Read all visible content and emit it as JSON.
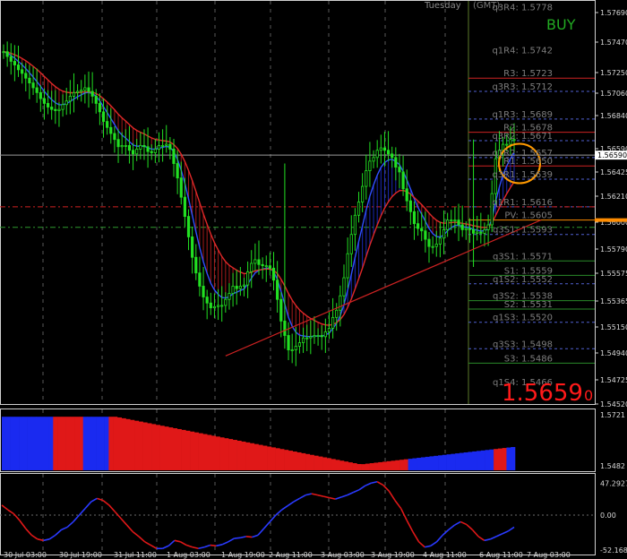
{
  "chart_data": {
    "type": "candlestick",
    "header": {
      "day_label": "Tuesday",
      "tz_label": "(GMT)",
      "signal": "BUY",
      "signal_color": "#22aa22",
      "price_big": "1.5659",
      "price_suffix": "0",
      "price_color": "#ff1a1a"
    },
    "price_axis": {
      "ylim": [
        1.5452,
        1.5788
      ],
      "ticks": [
        "1.57690",
        "1.57470",
        "1.57250",
        "1.57060",
        "1.56840",
        "1.56590",
        "1.56425",
        "1.56210",
        "1.56000",
        "1.55790",
        "1.55575",
        "1.55365",
        "1.55150",
        "1.54940",
        "1.54725",
        "1.54520"
      ],
      "current_price": "1.56590"
    },
    "pivot_levels": [
      {
        "label": "q3R4: 1.5778",
        "value": 1.5778,
        "color": "#606060",
        "style": "none"
      },
      {
        "label": "q1R4: 1.5742",
        "value": 1.5742,
        "color": "#606060",
        "style": "none"
      },
      {
        "label": "R3: 1.5723",
        "value": 1.5723,
        "color": "#cc2222",
        "style": "solid"
      },
      {
        "label": "q3R3: 1.5712",
        "value": 1.5712,
        "color": "#5060d0",
        "style": "dash"
      },
      {
        "label": "q1R3: 1.5689",
        "value": 1.5689,
        "color": "#5060d0",
        "style": "dash"
      },
      {
        "label": "R2: 1.5678",
        "value": 1.5678,
        "color": "#cc2222",
        "style": "solid"
      },
      {
        "label": "q3R2: 1.5671",
        "value": 1.5671,
        "color": "#5060d0",
        "style": "dash"
      },
      {
        "label": "q1R2: 1.5657",
        "value": 1.5657,
        "color": "#5060d0",
        "style": "dash"
      },
      {
        "label": "R1: 1.5650",
        "value": 1.565,
        "color": "#cc2222",
        "style": "solid"
      },
      {
        "label": "q3R1: 1.5639",
        "value": 1.5639,
        "color": "#5060d0",
        "style": "dash"
      },
      {
        "label": "q1R1: 1.5616",
        "value": 1.5616,
        "color": "#5060d0",
        "style": "dash"
      },
      {
        "label": "PV: 1.5605",
        "value": 1.5605,
        "color": "#ff8c00",
        "style": "solid"
      },
      {
        "label": "q3S1: 1.5593",
        "value": 1.5593,
        "color": "#5060d0",
        "style": "dash"
      },
      {
        "label": "q3S1: 1.5571",
        "value": 1.5571,
        "color": "#2a8a2a",
        "style": "solid"
      },
      {
        "label": "S1: 1.5559",
        "value": 1.5559,
        "color": "#2a8a2a",
        "style": "solid"
      },
      {
        "label": "q1S2: 1.5552",
        "value": 1.5552,
        "color": "#5060d0",
        "style": "dash"
      },
      {
        "label": "q3S2: 1.5538",
        "value": 1.5538,
        "color": "#2a8a2a",
        "style": "solid"
      },
      {
        "label": "S2: 1.5531",
        "value": 1.5531,
        "color": "#2a8a2a",
        "style": "solid"
      },
      {
        "label": "q1S3: 1.5520",
        "value": 1.552,
        "color": "#5060d0",
        "style": "dash"
      },
      {
        "label": "q3S3: 1.5498",
        "value": 1.5498,
        "color": "#5060d0",
        "style": "dash"
      },
      {
        "label": "S3: 1.5486",
        "value": 1.5486,
        "color": "#2a8a2a",
        "style": "solid"
      },
      {
        "label": "q1S4: 1.5466",
        "value": 1.5466,
        "color": "#606060",
        "style": "none"
      }
    ],
    "extra_lines": {
      "red_dashdot": 1.5616,
      "green_dashdot": 1.5599,
      "current_line_color": "#9a9a9a"
    },
    "trendline": {
      "from_idx": 60,
      "from_val": 1.5492,
      "to_idx": 176,
      "to_val": 1.5605,
      "color": "#cc2222"
    },
    "circle_annotation": {
      "idx": 165,
      "value": 1.5652,
      "color": "#ff9900"
    },
    "price_closes": [
      1.5745,
      1.5741,
      1.5737,
      1.5734,
      1.573,
      1.5727,
      1.5723,
      1.5719,
      1.5715,
      1.5711,
      1.5706,
      1.5702,
      1.5699,
      1.5697,
      1.5696,
      1.5697,
      1.5701,
      1.5704,
      1.5708,
      1.5711,
      1.5712,
      1.5713,
      1.5715,
      1.5712,
      1.5708,
      1.5702,
      1.5695,
      1.5687,
      1.5682,
      1.5677,
      1.5672,
      1.5666,
      1.5667,
      1.5667,
      1.5663,
      1.566,
      1.5664,
      1.5667,
      1.5666,
      1.5662,
      1.5661,
      1.5664,
      1.5667,
      1.5667,
      1.5668,
      1.5664,
      1.5652,
      1.564,
      1.5624,
      1.5608,
      1.5591,
      1.5574,
      1.5561,
      1.555,
      1.5541,
      1.5536,
      1.5532,
      1.5533,
      1.5534,
      1.5534,
      1.5539,
      1.5544,
      1.555,
      1.5548,
      1.555,
      1.5551,
      1.5562,
      1.5569,
      1.5572,
      1.5568,
      1.5567,
      1.5567,
      1.5565,
      1.5555,
      1.5539,
      1.5521,
      1.5509,
      1.5497,
      1.5497,
      1.55,
      1.5503,
      1.5507,
      1.5507,
      1.5508,
      1.5509,
      1.5509,
      1.5508,
      1.5512,
      1.5515,
      1.5524,
      1.553,
      1.5542,
      1.5557,
      1.5577,
      1.5593,
      1.5609,
      1.562,
      1.5633,
      1.5646,
      1.5654,
      1.5657,
      1.5663,
      1.5665,
      1.5663,
      1.566,
      1.5657,
      1.5649,
      1.5645,
      1.5631,
      1.5621,
      1.5612,
      1.5602,
      1.5598,
      1.5596,
      1.5589,
      1.5583,
      1.5583,
      1.5585,
      1.559,
      1.5597,
      1.5605,
      1.5605,
      1.5605,
      1.5601,
      1.5597,
      1.5598,
      1.5597,
      1.5594,
      1.5595,
      1.5594,
      1.5597,
      1.5601,
      1.5627,
      1.5656,
      1.5663,
      1.5668,
      1.5668,
      1.5672,
      1.5672
    ],
    "vol_axis": {
      "top": "1.5721",
      "bottom": "1.5482"
    },
    "vol_bars": [
      {
        "n": 12,
        "color": "blue"
      },
      {
        "n": 7,
        "color": "red"
      },
      {
        "n": 6,
        "color": "blue"
      },
      {
        "n": 70,
        "color": "red"
      },
      {
        "n": 20,
        "color": "blue"
      },
      {
        "n": 3,
        "color": "red"
      },
      {
        "n": 2,
        "color": "blue"
      }
    ],
    "osc_axis": {
      "top": "47.2927",
      "mid": "0.00",
      "bottom": "-52.1683"
    },
    "osc_values": [
      15,
      8,
      2,
      -8,
      -20,
      -30,
      -36,
      -38,
      -36,
      -30,
      -22,
      -18,
      -10,
      0,
      10,
      20,
      25,
      22,
      15,
      5,
      -5,
      -15,
      -25,
      -32,
      -40,
      -45,
      -50,
      -50,
      -46,
      -38,
      -40,
      -45,
      -48,
      -50,
      -48,
      -45,
      -46,
      -44,
      -40,
      -35,
      -34,
      -32,
      -33,
      -30,
      -20,
      -10,
      0,
      8,
      14,
      20,
      25,
      30,
      32,
      30,
      28,
      26,
      24,
      27,
      30,
      34,
      38,
      44,
      48,
      50,
      45,
      36,
      22,
      10,
      -8,
      -25,
      -40,
      -48,
      -46,
      -40,
      -30,
      -22,
      -15,
      -10,
      -14,
      -22,
      -32,
      -38,
      -36,
      -32,
      -28,
      -24,
      -18
    ],
    "time_labels": [
      "30 Jul 03:00",
      "30 Jul 19:00",
      "31 Jul 11:00",
      "1 Aug 03:00",
      "1 Aug 19:00",
      "2 Aug 11:00",
      "3 Aug 03:00",
      "3 Aug 19:00",
      "4 Aug 11:00",
      "6 Aug 11:00",
      "7 Aug 03:00"
    ]
  }
}
